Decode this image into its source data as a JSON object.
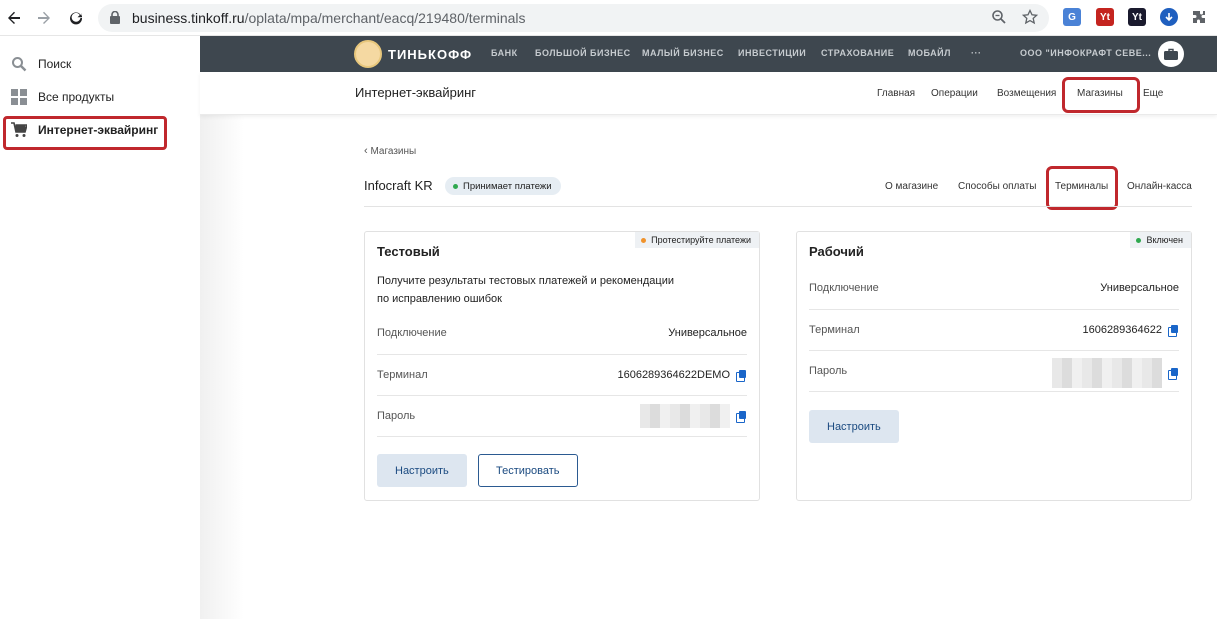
{
  "browser": {
    "url_host": "business.tinkoff.ru",
    "url_path": "/oplata/mpa/merchant/eacq/219480/terminals"
  },
  "sidebar": {
    "items": [
      {
        "label": "Поиск",
        "icon": "search-icon"
      },
      {
        "label": "Все продукты",
        "icon": "grid-icon"
      },
      {
        "label": "Интернет-эквайринг",
        "icon": "cart-icon"
      }
    ]
  },
  "topbar": {
    "logo_text": "ТИНЬКОФФ",
    "links": [
      "БАНК",
      "БОЛЬШОЙ БИЗНЕС",
      "МАЛЫЙ БИЗНЕС",
      "ИНВЕСТИЦИИ",
      "СТРАХОВАНИЕ",
      "МОБАЙЛ",
      "···"
    ],
    "company": "ООО \"ИНФОКРАФТ СЕВЕ..."
  },
  "header": {
    "title": "Интернет-эквайринг",
    "links": [
      "Главная",
      "Операции",
      "Возмещения",
      "Магазины",
      "Еще"
    ]
  },
  "store": {
    "breadcrumb": "Магазины",
    "name": "Infocraft KR",
    "status": "Принимает платежи",
    "tabs": [
      "О магазине",
      "Способы оплаты",
      "Терминалы",
      "Онлайн-касса"
    ]
  },
  "cards": {
    "test": {
      "badge": "Протестируйте платежи",
      "title": "Тестовый",
      "desc_line1": "Получите результаты тестовых платежей и рекомендации",
      "desc_line2": "по исправлению ошибок",
      "connection_label": "Подключение",
      "connection_value": "Универсальное",
      "terminal_label": "Терминал",
      "terminal_value": "1606289364622DEMO",
      "password_label": "Пароль",
      "configure_btn": "Настроить",
      "test_btn": "Тестировать"
    },
    "work": {
      "badge": "Включен",
      "title": "Рабочий",
      "connection_label": "Подключение",
      "connection_value": "Универсальное",
      "terminal_label": "Терминал",
      "terminal_value": "1606289364622",
      "password_label": "Пароль",
      "configure_btn": "Настроить"
    }
  },
  "colors": {
    "topbar": "#3e474f",
    "highlight": "#c0282d",
    "link_blue": "#1a66c9",
    "status_green": "#2fa84f",
    "status_orange": "#f0922b"
  }
}
